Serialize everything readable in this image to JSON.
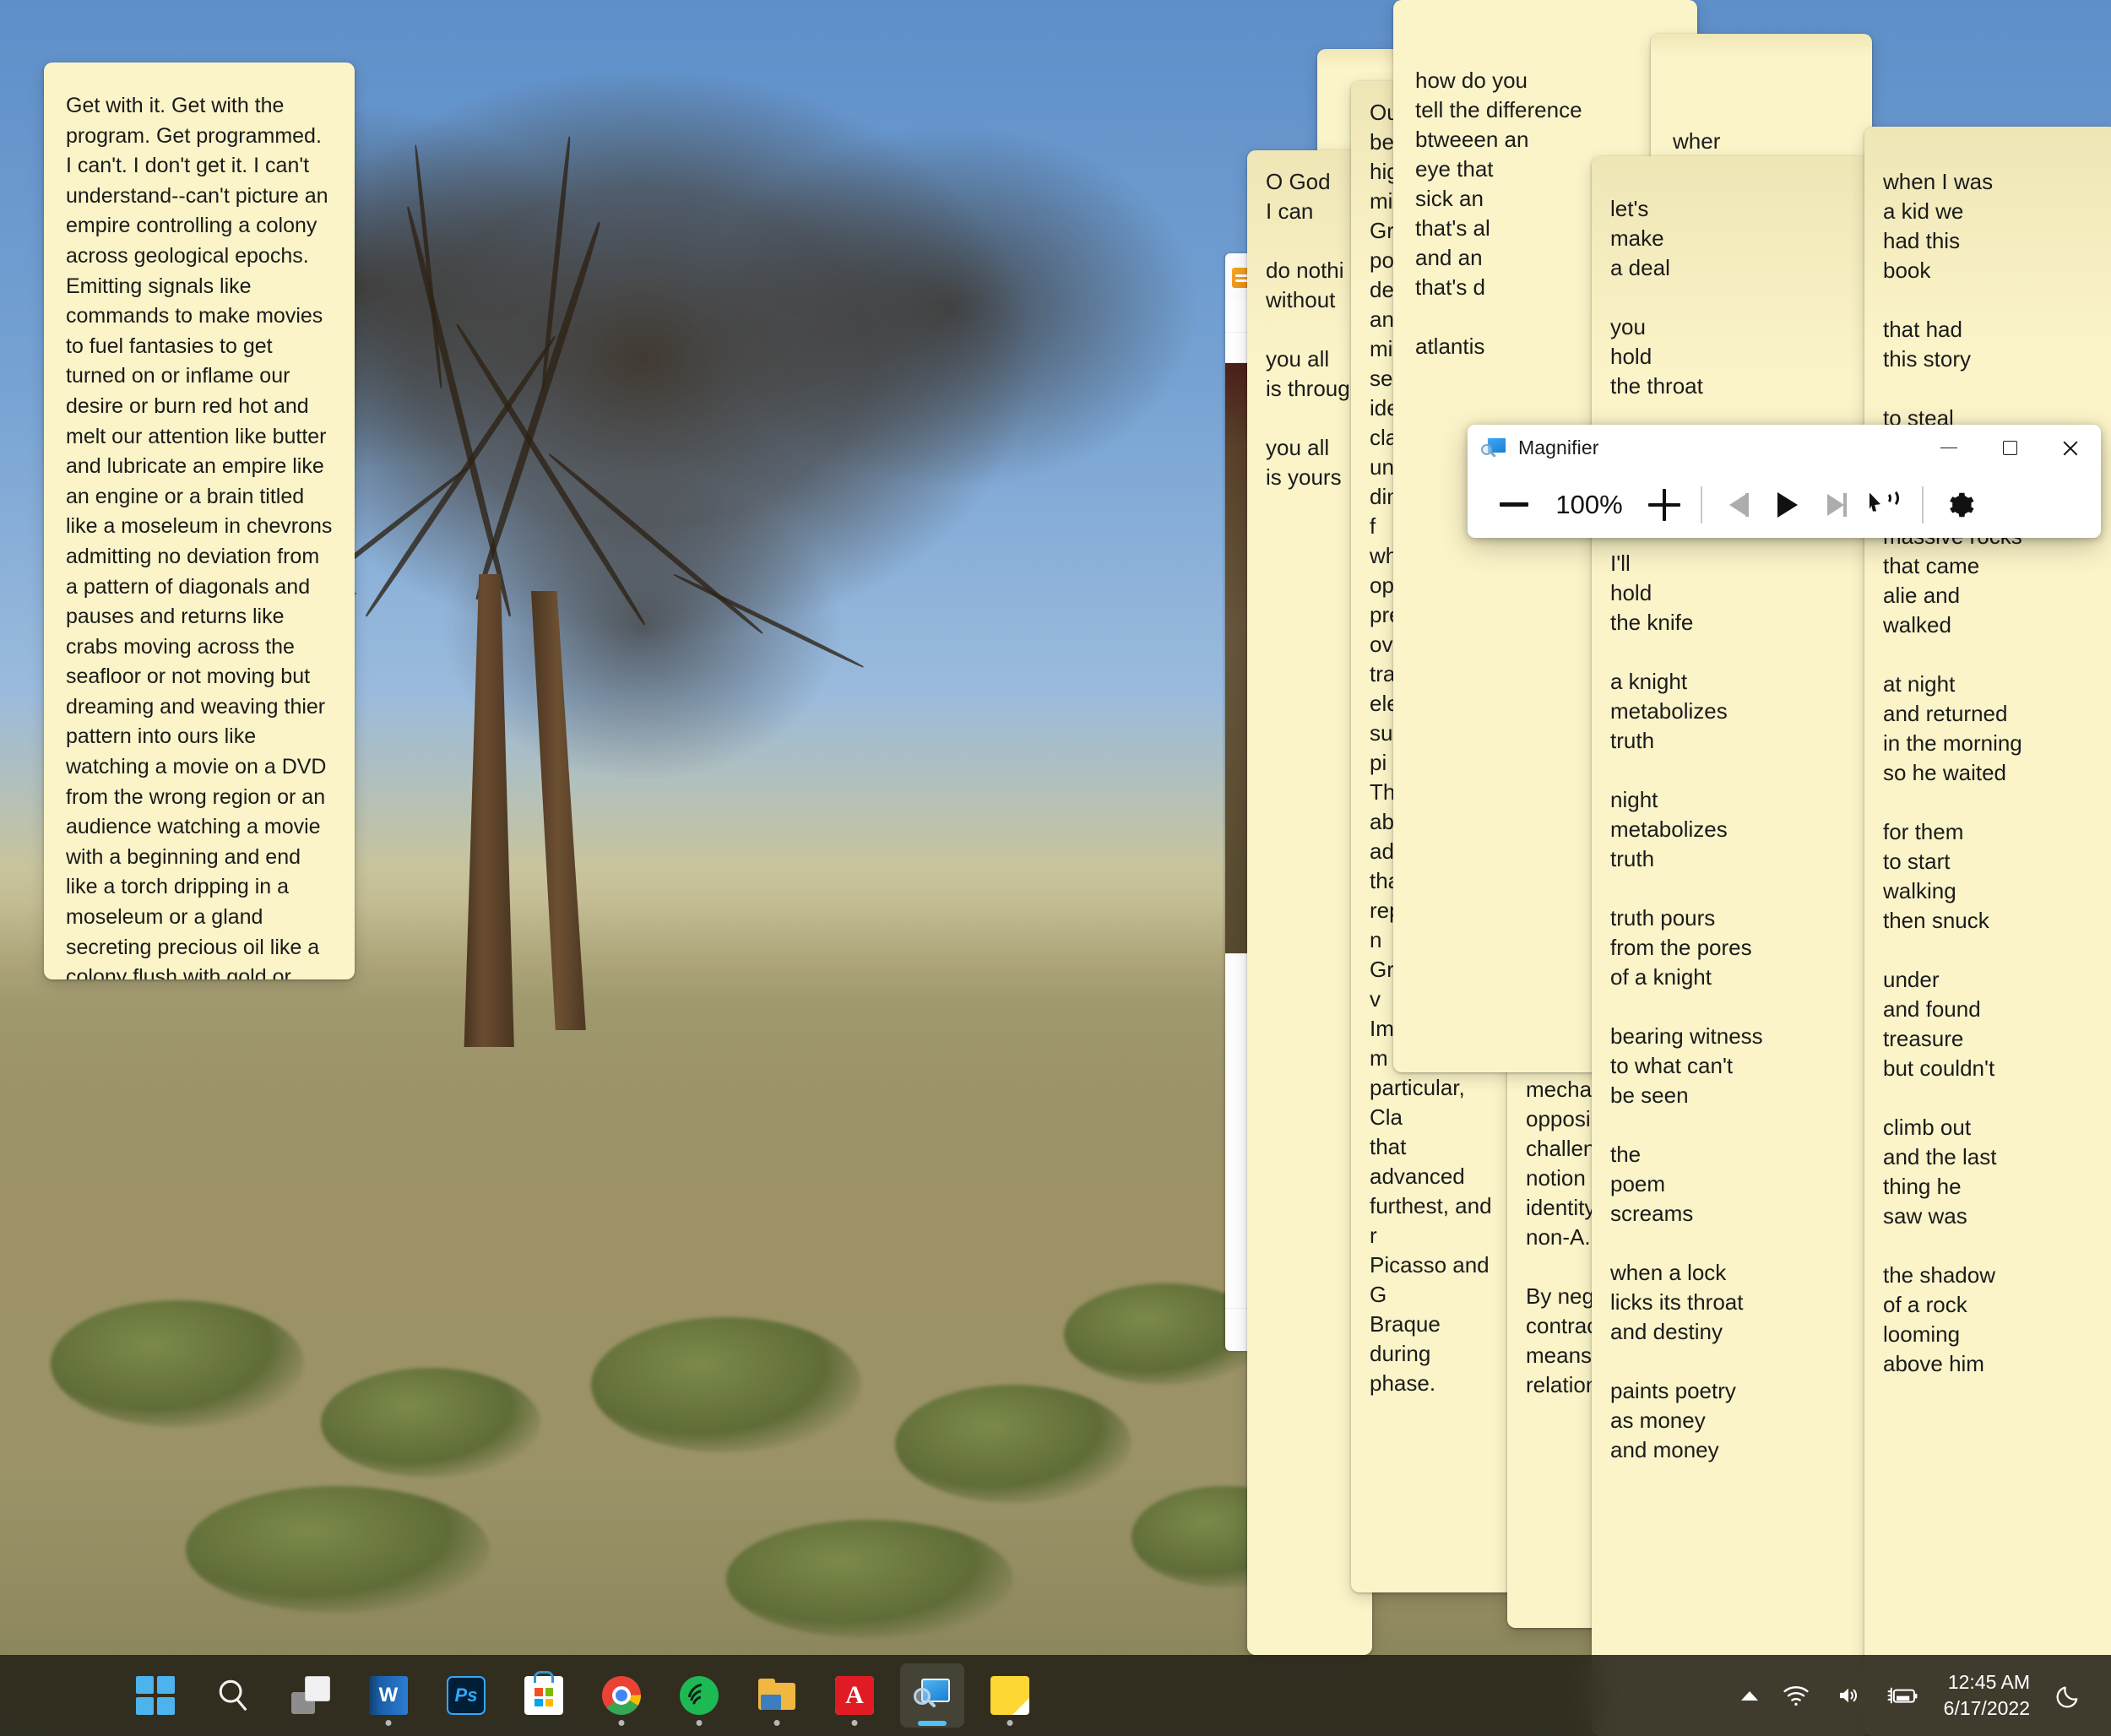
{
  "desktop": {
    "wallpaper_alt": "desert acacia tree against blue sky",
    "sky_color": "#6f9bd0",
    "ground_color": "#a2976c"
  },
  "notes": {
    "left_note": {
      "text": "Get with it. Get with the program. Get programmed. I can't. I don't get it. I can't understand--can't picture an empire controlling a colony across geological epochs. Emitting signals like commands to make movies to fuel fantasies to get turned on or inflame our desire or burn red hot and melt our attention like butter and lubricate an empire like an engine or a brain titled like a moseleum in chevrons admitting no deviation from a pattern of diagonals and pauses and returns like crabs moving across the seafloor or not moving but dreaming and weaving thier pattern into ours like watching a movie on a DVD from the wrong region or an audience watching a movie with a beginning and end like a torch dripping in a moseleum or a gland secreting precious oil like a colony flush with gold or love as rare as a steak or real as a blood in a movie or the magic that brings a lifeless recording to life. No hay banda! There is no band! Il n’y a pas dorchestra. This is all a tape recording. No hay banda, and yet we hear a band."
    },
    "ogod_note": {
      "text": "O God\nI can\n\ndo nothi\nwithout\n\nyou all\nis throug\n\nyou all\nis yours"
    },
    "outline_note": {
      "text": "Outl\nbetv\nhigh\nmid\nGree\npoin\ndefi\nand\nmim\nsear\nidentity, ad\nclarifies its\nuniquenes\ndimensional, f\nwhere the opt\nprecedence ov\ntraditional ele\nsubject and pi\nThird, abstract\nadvanced thar\nrepresentation\nGreenberg’s v\nImpressionism\nparticular, Cla\nthat advanced\nfurthest, and r\nPicasso and G\nBraque during\nphase."
    },
    "what_note": {
      "text": "“What\nand po\nmetapl\none ca\npoetry\ncalled\ncreates\n\n\n\nDenkta\n728 (A\n(transla\n\nHegel\naspect\npower\nby mea\n\"negat\nthat th\nbecom\ndissolv\nadapta\neagern\ntoward\n\nDialect\nits dyn\nfrom it\n\"contra\nalmost\nidentity\n\nHegel's\ndoes n\nmecha\nopposi\nchallen\nnotion\nidentity\nnon-A.\n\nBy neg\ncontrac\nmeans\nrelation"
    },
    "howdo_note": {
      "text": "how do you\ntell the difference\nbtweeen an\neye that\nsick an\nthat's al\nand an\nthat's d\n\natlantis"
    },
    "when_note": {
      "text": "wher"
    },
    "lets_note": {
      "text": "let's\nmake\na deal\n\nyou\nhold\nthe throat\n\nyou\nbear\nthe cross\n\nI'll\nhold\nthe knife\n\na knight\nmetabolizes\ntruth\n\nnight\nmetabolizes\ntruth\n\ntruth pours\nfrom the pores\nof a knight\n\nbearing witness\nto what can't\nbe seen\n\nthe\npoem\nscreams\n\nwhen a lock\nlicks its throat\nand destiny\n\npaints poetry\nas money\nand money"
    },
    "kid_note": {
      "text": "when I was\na kid we\nhad this\nbook\n\nthat had\nthis story\n\nto steal\ntreasure\nhidden under\n\nmassive rocks\nthat came\nalie and\nwalked\n\nat night\nand returned\nin the morning\nso he waited\n\nfor them\nto start\nwalking\nthen snuck\n\nunder\nand found\ntreasure\nbut couldn't\n\nclimb out\nand the last\nthing he\nsaw was\n\nthe shadow\nof a rock\nlooming\nabove him"
    }
  },
  "magnifier": {
    "title": "Magnifier",
    "app_icon": "magnifier-icon",
    "window_controls": {
      "minimize": "–",
      "maximize": "□",
      "close": "✕"
    },
    "toolbar": {
      "zoom_out_label": "−",
      "zoom_level": "100%",
      "zoom_in_label": "+",
      "previous_label": "Previous sentence",
      "play_label": "Play",
      "next_label": "Next sentence",
      "read_from_here_label": "Read from here",
      "settings_label": "Settings"
    }
  },
  "taskbar": {
    "items": [
      {
        "name": "start",
        "label": "Start",
        "icon": "windows-logo-icon",
        "running": false,
        "active": false
      },
      {
        "name": "search",
        "label": "Search",
        "icon": "search-icon",
        "running": false,
        "active": false
      },
      {
        "name": "task-view",
        "label": "Task View",
        "icon": "task-view-icon",
        "running": false,
        "active": false
      },
      {
        "name": "word",
        "label": "Word",
        "icon": "word-icon",
        "running": true,
        "active": false
      },
      {
        "name": "photoshop",
        "label": "Photoshop",
        "icon": "photoshop-icon",
        "running": false,
        "active": false
      },
      {
        "name": "store",
        "label": "Microsoft Store",
        "icon": "microsoft-store-icon",
        "running": false,
        "active": false
      },
      {
        "name": "chrome",
        "label": "Google Chrome",
        "icon": "chrome-icon",
        "running": true,
        "active": false
      },
      {
        "name": "spotify",
        "label": "Spotify",
        "icon": "spotify-icon",
        "running": true,
        "active": false
      },
      {
        "name": "file-explorer",
        "label": "File Explorer",
        "icon": "folder-icon",
        "running": true,
        "active": false
      },
      {
        "name": "acrobat",
        "label": "Adobe Acrobat",
        "icon": "acrobat-icon",
        "running": true,
        "active": false
      },
      {
        "name": "magnifier",
        "label": "Magnifier",
        "icon": "magnifier-icon",
        "running": true,
        "active": true
      },
      {
        "name": "sticky-notes",
        "label": "Sticky Notes",
        "icon": "sticky-note-icon",
        "running": true,
        "active": false
      }
    ],
    "tray": {
      "show_hidden_label": "Show hidden icons",
      "wifi_label": "Network",
      "volume_label": "Volume",
      "battery_label": "Battery charging",
      "time": "12:45 AM",
      "date": "6/17/2022",
      "notifications_label": "Do not disturb"
    }
  }
}
